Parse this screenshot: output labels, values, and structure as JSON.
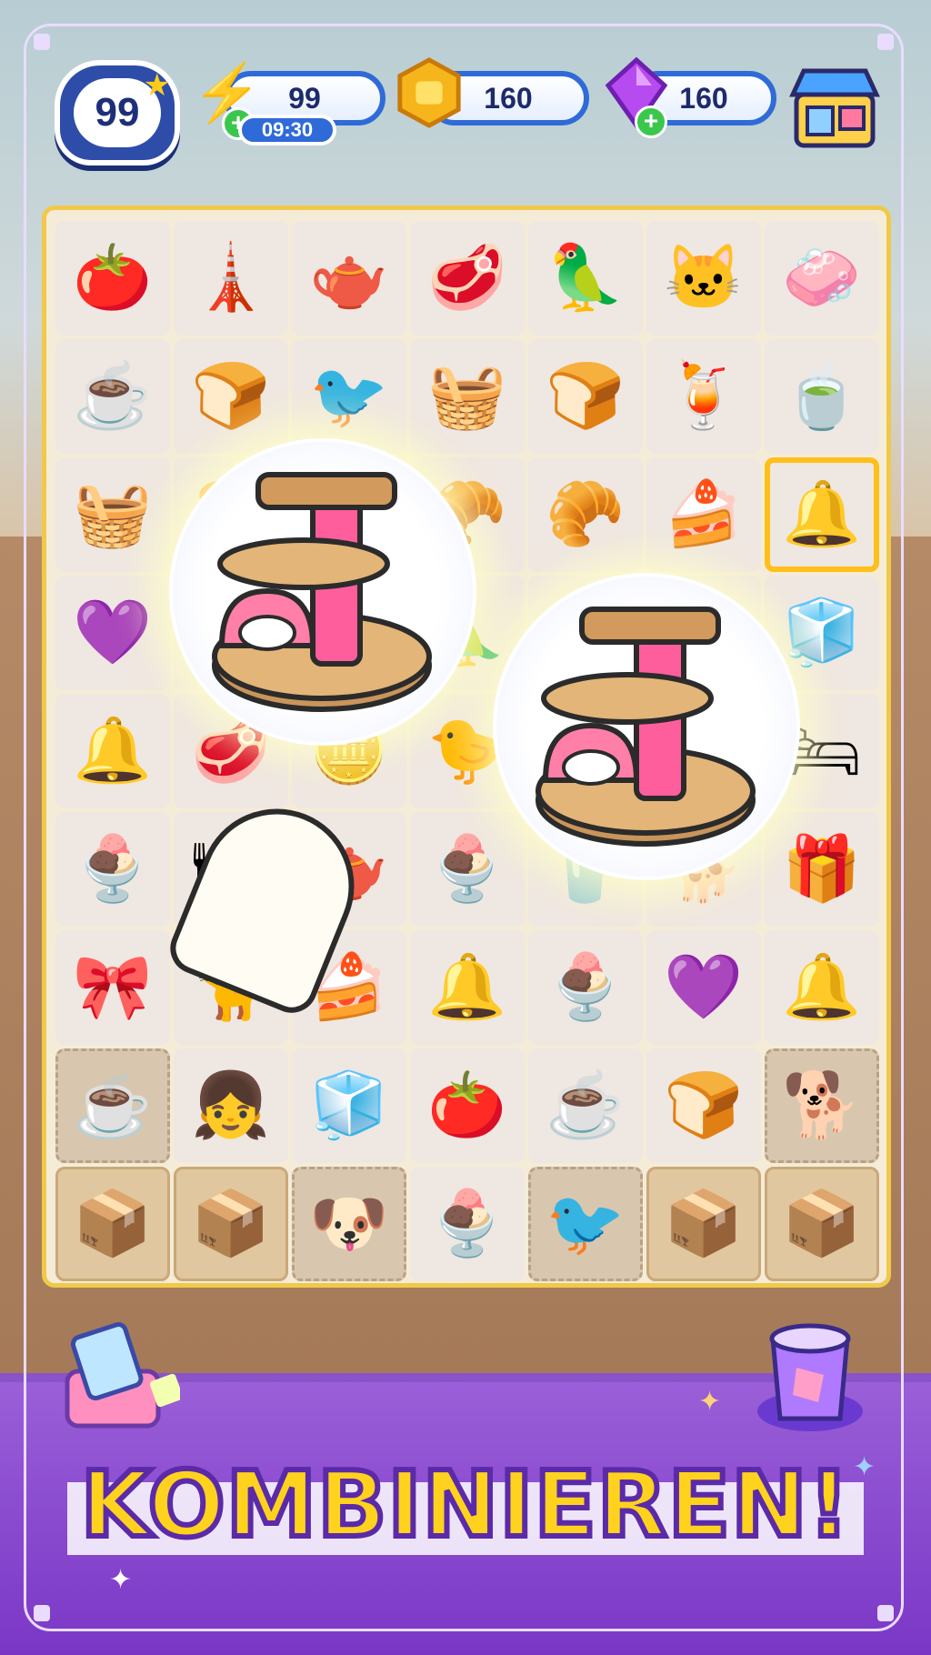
{
  "hud": {
    "level": "99",
    "energy": "99",
    "energy_timer": "09:30",
    "coins": "160",
    "gems": "160"
  },
  "banner": {
    "text": "KOMBINIEREN!"
  },
  "colors": {
    "board_border": "#f1c94a",
    "pill_border": "#2f6bd8",
    "banner_text": "#ffd21e",
    "banner_stroke": "#5b2aa8",
    "purple": "#7a37c6"
  },
  "board": {
    "rows": [
      [
        "tomato",
        "cat-tower",
        "teapot",
        "steak",
        "cockatoo",
        "pink-cat",
        "soap"
      ],
      [
        "coffee-cup",
        "bun",
        "robin",
        "veggie-basket",
        "bun",
        "lemon-drink",
        "tea-bag"
      ],
      [
        "pet-bed",
        "pancakes",
        "jewel-box",
        "croissant",
        "croissant",
        "orange-cake",
        "cat-bell"
      ],
      [
        "purple-gem",
        "cat-tower",
        "leaf",
        "parrot",
        "parrot",
        "steak",
        "meat-fridge"
      ],
      [
        "cat-bell",
        "steak",
        "coins",
        "bird",
        "fan",
        "mint-drink",
        "cat-bed"
      ],
      [
        "bear-parfait",
        "food-plate",
        "teapot",
        "bear-parfait",
        "soda",
        "shiba",
        "gift-box"
      ],
      [
        "pink-cat-bed",
        "calico-cat",
        "orange-cake",
        "cat-bell",
        "bear-parfait",
        "purple-gem",
        "cat-bell"
      ],
      [
        "locked-coffee-maker",
        "blonde-girl",
        "meat-fridge",
        "tomato",
        "coffee-cup",
        "bun",
        "locked-shiba"
      ],
      [
        "box",
        "box",
        "locked-shiba-pup",
        "bear-parfait",
        "locked-bird-cage",
        "box",
        "box"
      ]
    ]
  }
}
